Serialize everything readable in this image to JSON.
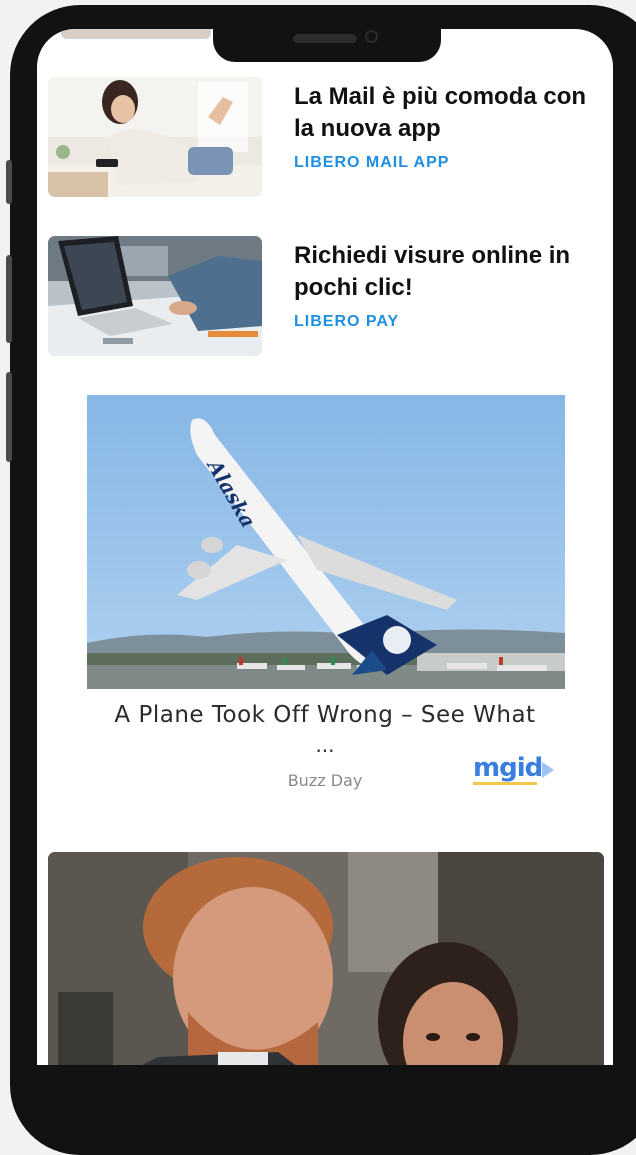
{
  "articles": [
    {
      "title": "La Mail è più comoda con la nuova app",
      "source": "LIBERO MAIL APP",
      "image": "woman-with-phone-photo"
    },
    {
      "title": "Richiedi visure online in pochi clic!",
      "source": "LIBERO PAY",
      "image": "laptop-desk-photo"
    }
  ],
  "ad": {
    "title": "A Plane Took Off Wrong – See What",
    "ellipsis": "...",
    "source": "Buzz Day",
    "brand": "mgid",
    "image": "airplane-takeoff-photo",
    "aircraft_livery": "Alaska"
  },
  "next_article": {
    "image": "couple-portrait-photo"
  },
  "colors": {
    "source_label": "#1f8fe0",
    "brand": "#3a7ee0",
    "frame": "#121212"
  }
}
